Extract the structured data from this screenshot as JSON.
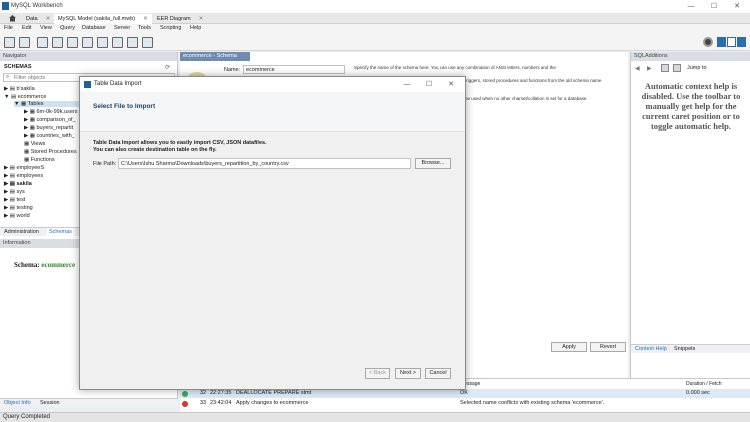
{
  "window": {
    "title": "MySQL Workbench",
    "minimize": "—",
    "maximize": "☐",
    "close": "✕"
  },
  "tabs": [
    {
      "label": "Data"
    },
    {
      "label": "MySQL Model (sakila_full.mwb)"
    },
    {
      "label": "EER Diagram"
    }
  ],
  "menu": [
    "File",
    "Edit",
    "View",
    "Query",
    "Database",
    "Server",
    "Tools",
    "Scripting",
    "Help"
  ],
  "navigator": {
    "header": "Navigator",
    "schemas_label": "SCHEMAS",
    "filter_placeholder": "Filter objects",
    "tree": {
      "b_sakila": "b'sakila",
      "ecommerce": "ecommerce",
      "tables": "Tables",
      "table_items": [
        "6m-0k-99k.users",
        "comparison_of_",
        "buyers_repartit",
        "countries_with_"
      ],
      "views": "Views",
      "stored_procedures": "Stored Procedures",
      "functions": "Functions",
      "others": [
        "employeeS",
        "employees",
        "sakila",
        "sys",
        "test",
        "testing",
        "world"
      ]
    },
    "bottom_tabs": [
      "Administration",
      "Schemas"
    ],
    "info_header": "Information",
    "schema_label": "Schema:",
    "schema_value": "ecommerce",
    "object_tabs": [
      "Object Info",
      "Session"
    ]
  },
  "editor": {
    "tab": "ecommerce - Schema",
    "name_label": "Name:",
    "name_value": "ecommerce",
    "hint1": "Specify the name of the schema here. You can use any combination of ANSI letters, numbers and the",
    "hint2": "triggers, stored procedures and functions from the old schema name",
    "hint3": "be used when no other charset/collation is set for a database.",
    "apply": "Apply",
    "revert": "Revert"
  },
  "sql_additions": {
    "header": "SQLAdditions",
    "jump": "Jump to",
    "help_text": "Automatic context help is disabled. Use the toolbar to manually get help for the current caret position or to toggle automatic help.",
    "tabs": [
      "Context Help",
      "Snippets"
    ]
  },
  "output": {
    "col_message": "Message",
    "col_duration": "Duration / Fetch",
    "rows": [
      {
        "num": "32",
        "time": "22:27:35",
        "action": "DEALLOCATE PREPARE stmt",
        "message": "OK",
        "duration": "0.000 sec",
        "status": "ok"
      },
      {
        "num": "33",
        "time": "23:42:04",
        "action": "Apply changes to ecommerce",
        "message": "Selected name conflicts with existing schema 'ecommerce'.",
        "duration": "",
        "status": "error"
      }
    ]
  },
  "status_text": "Query Completed",
  "dialog": {
    "title": "Table Data Import",
    "heading": "Select File to Import",
    "desc1": "Table Data Import allows you to easily import CSV, JSON datafiles.",
    "desc2": "You can also create destination table on the fly.",
    "file_label": "File Path:",
    "file_value": "C:\\Users\\Ishu Sharma\\Downloads\\buyers_repartition_by_country.csv",
    "browse": "Browse...",
    "back": "< Back",
    "next": "Next >",
    "cancel": "Cancel",
    "minimize": "—",
    "maximize": "☐",
    "close": "✕"
  },
  "colors": {
    "ok": "#3aa857",
    "error": "#d9342b",
    "link": "#1c6ec8",
    "schema_value": "#2a8a2a"
  }
}
